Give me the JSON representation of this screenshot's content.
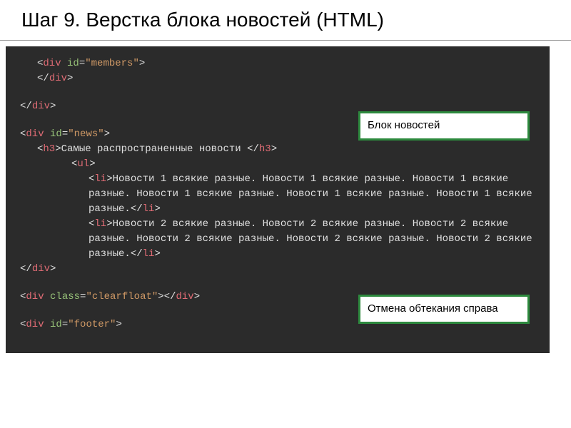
{
  "title": "Шаг 9. Верстка блока новостей (HTML)",
  "callouts": {
    "news_block": "Блок новостей",
    "clearfloat": "Отмена обтекания справа"
  },
  "code": {
    "members_open": "<div id=\"members\">",
    "members_close": "</div>",
    "outer_close": "</div>",
    "news_open": "<div id=\"news\">",
    "h3_open": "<h3>",
    "h3_text": "Самые распространенные новости ",
    "h3_close": "</h3>",
    "ul_open": "<ul>",
    "li1": "Новости 1 всякие разные. Новости 1 всякие разные. Новости 1 всякие разные. Новости 1 всякие разные. Новости 1 всякие разные. Новости 1 всякие разные.",
    "li2": "Новости 2 всякие разные. Новости 2 всякие разные. Новости 2 всякие разные. Новости 2 всякие разные. Новости 2 всякие разные. Новости 2 всякие разные.",
    "news_close": "</div>",
    "clearfloat": "<div class=\"clearfloat\"></div>",
    "footer": "<div id=\"footer\">"
  }
}
